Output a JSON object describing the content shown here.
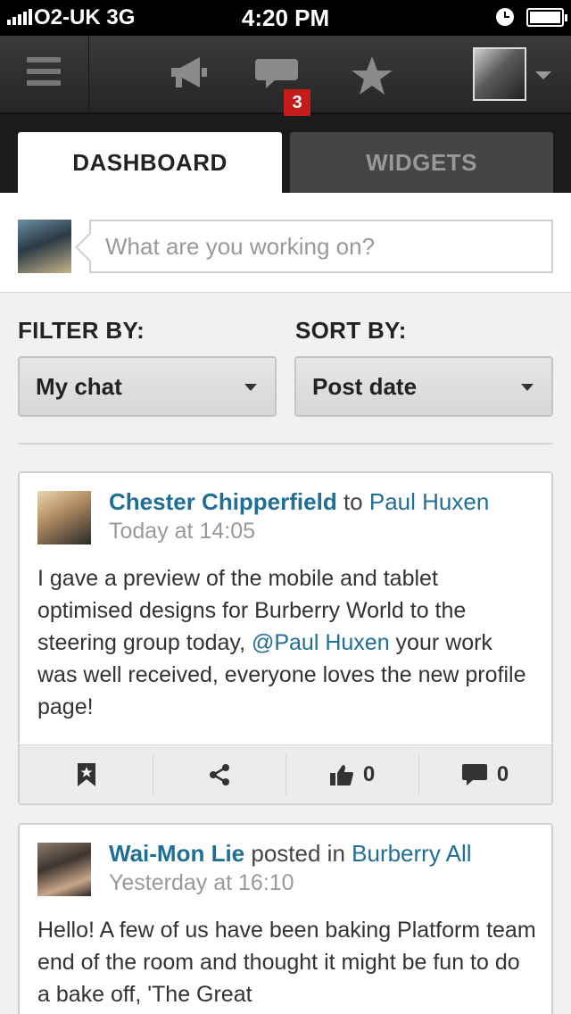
{
  "status_bar": {
    "carrier": "O2-UK  3G",
    "time": "4:20 PM"
  },
  "nav": {
    "messages_badge": "3"
  },
  "tabs": [
    {
      "label": "DASHBOARD",
      "active": true
    },
    {
      "label": "WIDGETS",
      "active": false
    }
  ],
  "composer": {
    "placeholder": "What are you working on?"
  },
  "filter": {
    "label": "FILTER BY:",
    "selected": "My chat"
  },
  "sort": {
    "label": "SORT BY:",
    "selected": "Post date"
  },
  "posts": [
    {
      "author": "Chester Chipperfield",
      "connector": "to",
      "target": "Paul Huxen",
      "time": "Today at 14:05",
      "body_before": "I gave a preview of the mobile and tablet optimised designs for Burberry World to the steering group today, ",
      "mention": "@Paul Huxen",
      "body_after": " your work was well received, everyone loves the new profile page!",
      "likes": "0",
      "comments": "0"
    },
    {
      "author": "Wai-Mon Lie",
      "connector": "posted in",
      "target": "Burberry All",
      "time": "Yesterday at 16:10",
      "body": "Hello! A few of us have been baking Platform team end of the room and thought it might be fun to do a bake off, 'The Great"
    }
  ],
  "colors": {
    "link": "#1f6e96",
    "badge": "#c61b1b",
    "nav_bg": "#2e2e2e",
    "tab_bar_bg": "#1b1b1b"
  },
  "icons": [
    "menu-icon",
    "megaphone-icon",
    "chat-icon",
    "star-icon",
    "bookmark-icon",
    "share-icon",
    "thumbs-up-icon",
    "comment-icon"
  ]
}
